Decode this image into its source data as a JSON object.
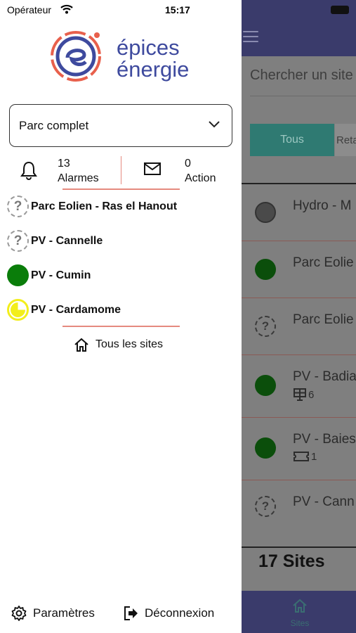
{
  "status_bar": {
    "operator": "Opérateur",
    "time": "15:17"
  },
  "logo": {
    "line1": "épices",
    "line2": "énergie"
  },
  "park_selector": {
    "value": "Parc complet"
  },
  "stats": {
    "alarms": {
      "count": "13",
      "label": "Alarmes"
    },
    "actions": {
      "count": "0",
      "label": "Action"
    }
  },
  "sites": [
    {
      "name": "Parc Eolien - Ras el Hanout",
      "status_icon": "unknown-icon"
    },
    {
      "name": "PV - Cannelle",
      "status_icon": "unknown-icon"
    },
    {
      "name": "PV - Cumin",
      "status_icon": "ok-dot-icon"
    },
    {
      "name": "PV - Cardamome",
      "status_icon": "night-icon"
    }
  ],
  "all_sites_label": "Tous les sites",
  "footer": {
    "settings_label": "Paramètres",
    "logout_label": "Déconnexion"
  },
  "background": {
    "search_placeholder": "Chercher un site",
    "filter_active": "Tous",
    "filter_other": "Reta",
    "rows": [
      {
        "name": "Hydro - M",
        "icon": "clock-icon"
      },
      {
        "name": "Parc Eolie",
        "icon": "ok-dot-icon"
      },
      {
        "name": "Parc Eolie",
        "icon": "unknown-icon"
      },
      {
        "name": "PV - Badia",
        "icon": "ok-dot-icon",
        "sub_count": "6",
        "sub_icon": "solar-panel-icon"
      },
      {
        "name": "PV - Baies",
        "icon": "ok-dot-icon",
        "sub_count": "1",
        "sub_icon": "ticket-icon"
      },
      {
        "name": "PV - Cann",
        "icon": "unknown-icon"
      }
    ],
    "site_count": "17 Sites",
    "tab_label": "Sites"
  },
  "colors": {
    "brand_blue": "#3e4a9e",
    "accent_red": "#e58a7f",
    "ok_green": "#0a7d0a",
    "night_yellow": "#f2ee1c"
  }
}
